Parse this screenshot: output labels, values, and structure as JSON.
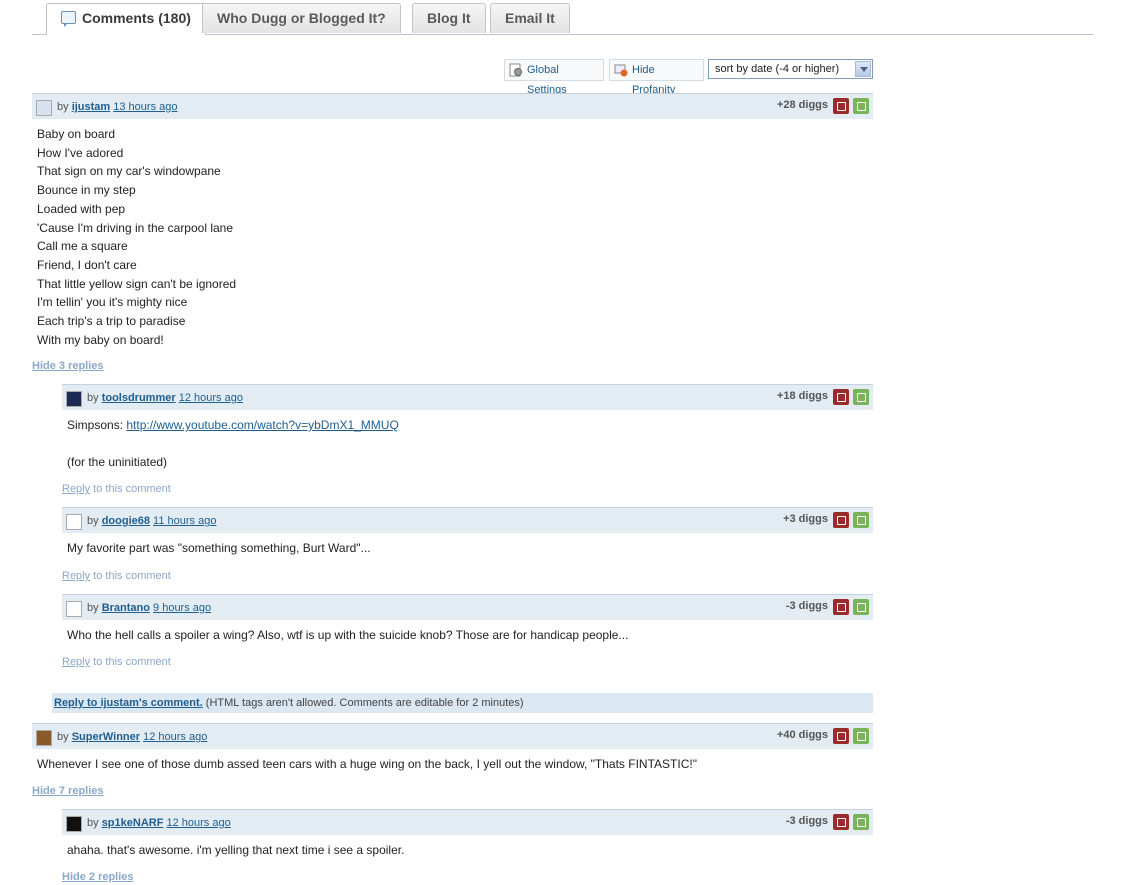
{
  "tabs": [
    {
      "label": "Comments (180)"
    },
    {
      "label": "Who Dugg or Blogged It?"
    },
    {
      "label": "Blog It"
    },
    {
      "label": "Email It"
    }
  ],
  "toolbar": {
    "global_settings": "Global Settings",
    "hide_profanity": "Hide Profanity",
    "sort_value": "sort by date (-4 or higher)"
  },
  "comments": [
    {
      "user": "ijustam",
      "time": "13 hours ago",
      "diggs": "+28 diggs",
      "lines": [
        "Baby on board",
        "How I've adored",
        "That sign on my car's windowpane",
        "Bounce in my step",
        "Loaded with pep",
        "'Cause I'm driving in the carpool lane",
        "Call me a square",
        "Friend, I don't care",
        "That little yellow sign can't be ignored",
        "I'm tellin' you it's mighty nice",
        "Each trip's a trip to paradise",
        "With my baby on board!"
      ],
      "toggle": "Hide 3 replies"
    },
    {
      "user": "toolsdrummer",
      "time": "12 hours ago",
      "diggs": "+18 diggs",
      "prefix": "Simpsons: ",
      "url": "http://www.youtube.com/watch?v=ybDmX1_MMUQ",
      "line2": "(for the uninitiated)"
    },
    {
      "user": "doogie68",
      "time": "11 hours ago",
      "diggs": "+3 diggs",
      "text": "My favorite part was \"something something, Burt Ward\"..."
    },
    {
      "user": "Brantano",
      "time": "9 hours ago",
      "diggs": "-3 diggs",
      "text": "Who the hell calls a spoiler a wing? Also, wtf is up with the suicide knob? Those are for handicap people..."
    },
    {
      "user": "SuperWinner",
      "time": "12 hours ago",
      "diggs": "+40 diggs",
      "text": "Whenever I see one of those dumb assed teen cars with a huge wing on the back, I yell out the window, \"Thats FINTASTIC!\"",
      "toggle": "Hide 7 replies"
    },
    {
      "user": "sp1keNARF",
      "time": "12 hours ago",
      "diggs": "-3 diggs",
      "text": "ahaha. that's awesome. i'm yelling that next time i see a spoiler.",
      "toggle": "Hide 2 replies"
    }
  ],
  "common": {
    "by": "by",
    "reply_link": "Reply",
    "reply_suffix": " to this comment"
  },
  "reply_bar": {
    "link": "Reply to ijustam's comment.",
    "note": " (HTML tags aren't allowed. Comments are editable for 2 minutes)"
  }
}
